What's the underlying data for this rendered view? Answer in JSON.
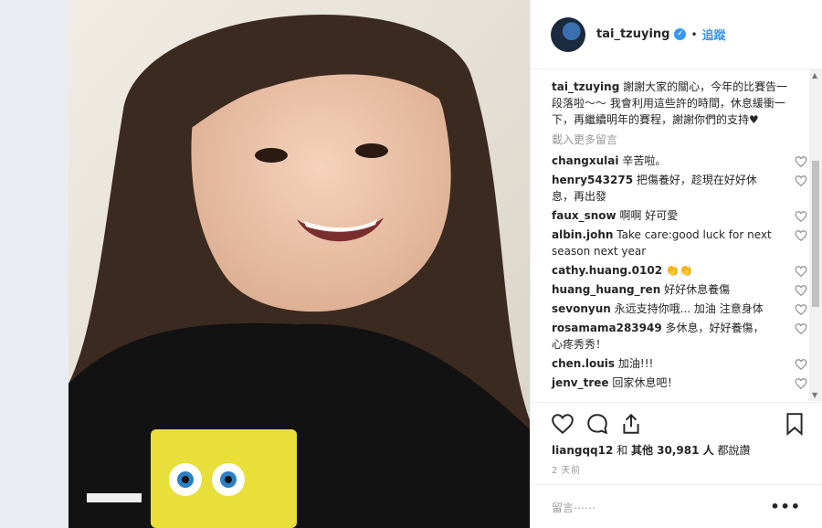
{
  "post": {
    "username": "tai_tzuying",
    "follow_label": "追蹤",
    "separator": "•",
    "caption_user": "tai_tzuying",
    "caption_text": "謝謝大家的關心，今年的比賽告一段落啦～～ 我會利用這些許的時間，休息緩衝一下，再繼續明年的賽程，謝謝你們的支持♥",
    "load_more": "載入更多留言"
  },
  "comments": [
    {
      "user": "changxulai",
      "text": "辛苦啦。"
    },
    {
      "user": "henry543275",
      "text": "把傷養好，趁現在好好休息，再出發"
    },
    {
      "user": "faux_snow",
      "text": "啊啊 好可愛"
    },
    {
      "user": "albin.john",
      "text": "Take care:good luck for next season next year"
    },
    {
      "user": "cathy.huang.0102",
      "text": "👏👏"
    },
    {
      "user": "huang_huang_ren",
      "text": "好好休息養傷"
    },
    {
      "user": "sevonyun",
      "text": "永远支持你哦... 加油 注意身体"
    },
    {
      "user": "rosamama283949",
      "text": "多休息，好好養傷，心疼秀秀！"
    },
    {
      "user": "chen.louis",
      "text": "加油!!!"
    },
    {
      "user": "jenv_tree",
      "text": "回家休息吧！"
    }
  ],
  "likes": {
    "first_user": "liangqq12",
    "and": " 和 ",
    "others": "其他 30,981 人",
    "suffix": " 都說讚"
  },
  "time_ago": "2 天前",
  "add_comment_placeholder": "留言⋯⋯",
  "more_options": "•••",
  "colors": {
    "accent": "#3897f0",
    "muted": "#999999",
    "text": "#262626"
  }
}
